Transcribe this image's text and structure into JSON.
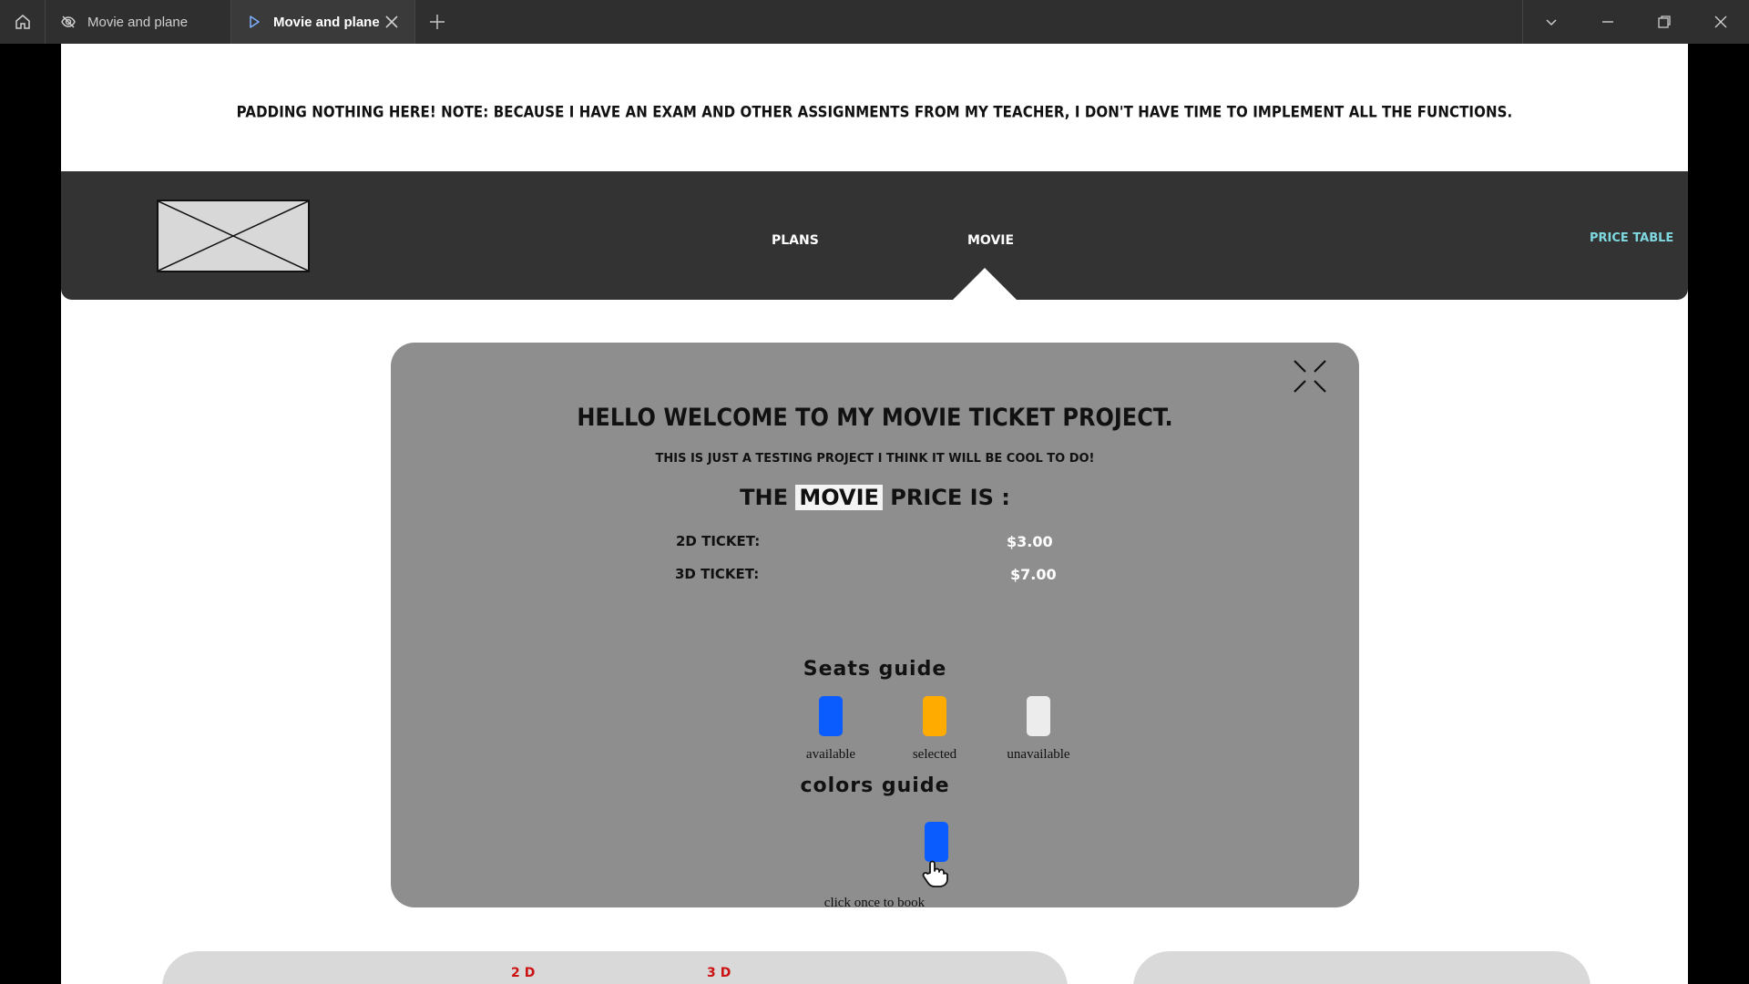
{
  "titlebar": {
    "tabs": [
      {
        "label": "Movie and plane",
        "icon": "eye-slash-icon",
        "active": false
      },
      {
        "label": "Movie and plane",
        "icon": "play-icon",
        "active": true
      }
    ]
  },
  "notice": "PADDING NOTHING HERE! NOTE: BECAUSE I HAVE AN EXAM AND OTHER ASSIGNMENTS FROM MY TEACHER, I DON'T HAVE TIME TO IMPLEMENT ALL THE FUNCTIONS.",
  "nav": {
    "items": [
      "PLANS",
      "MOVIE"
    ],
    "price_table": "PRICE TABLE",
    "active": "MOVIE"
  },
  "panel": {
    "title": "HELLO WELCOME TO MY MOVIE TICKET PROJECT.",
    "subtitle": "THIS IS JUST A TESTING PROJECT I THINK IT WILL BE COOL TO DO!",
    "price_prefix": "THE",
    "price_highlight": "MOVIE",
    "price_suffix": "PRICE IS :",
    "tickets": [
      {
        "label": "2D TICKET:",
        "value": "$3.00"
      },
      {
        "label": "3D TICKET:",
        "value": "$7.00"
      }
    ],
    "seats_guide_title": "Seats guide",
    "seats": [
      {
        "label": "available",
        "color": "#0a5cff"
      },
      {
        "label": "selected",
        "color": "#ffab00"
      },
      {
        "label": "unavailable",
        "color": "#ececec"
      }
    ],
    "colors_guide_title": "colors guide",
    "click_label": "click once to book",
    "click_seat_color": "#0a5cff"
  },
  "bottom": {
    "tab_2d": "2D",
    "tab_3d": "3D"
  }
}
